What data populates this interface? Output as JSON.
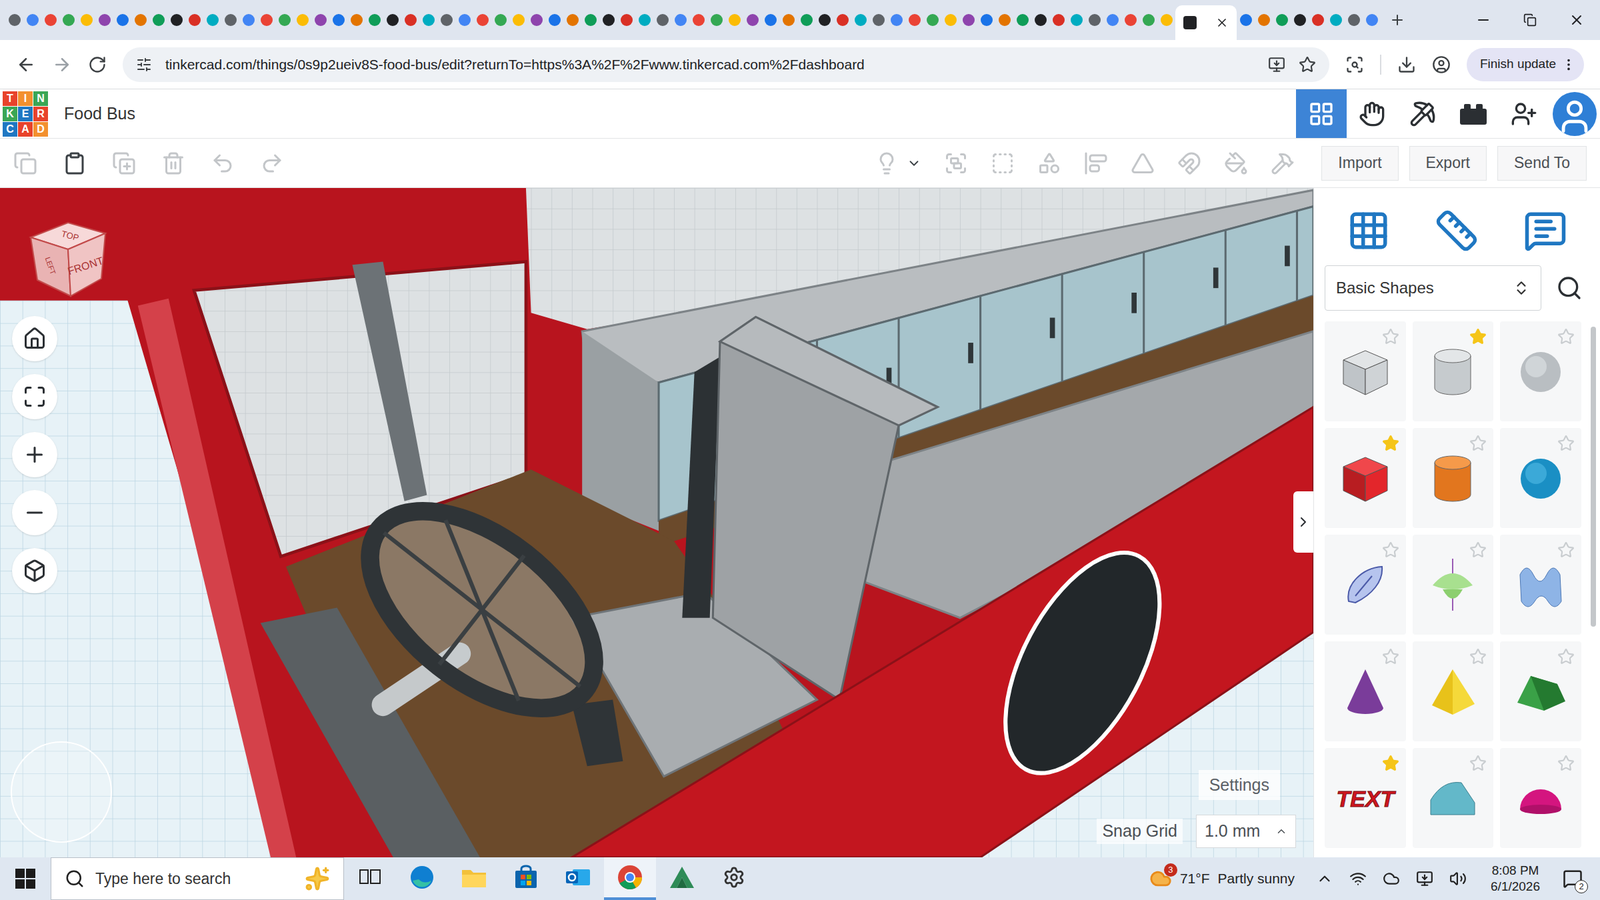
{
  "browser": {
    "tabs": [
      {
        "selected": false
      },
      {
        "selected": false
      },
      {
        "selected": false
      },
      {
        "selected": false
      },
      {
        "selected": false
      },
      {
        "selected": false
      },
      {
        "selected": false
      },
      {
        "selected": false
      },
      {
        "selected": false
      },
      {
        "selected": false
      },
      {
        "selected": false
      },
      {
        "selected": false
      },
      {
        "selected": false
      },
      {
        "selected": false
      },
      {
        "selected": false
      },
      {
        "selected": false
      },
      {
        "selected": false
      },
      {
        "selected": false
      },
      {
        "selected": false
      },
      {
        "selected": false
      },
      {
        "selected": false
      },
      {
        "selected": false
      },
      {
        "selected": false
      },
      {
        "selected": false
      },
      {
        "selected": false
      },
      {
        "selected": false
      },
      {
        "selected": false
      },
      {
        "selected": false
      },
      {
        "selected": false
      },
      {
        "selected": false
      },
      {
        "selected": false
      },
      {
        "selected": false
      },
      {
        "selected": false
      },
      {
        "selected": false
      },
      {
        "selected": false
      },
      {
        "selected": false
      },
      {
        "selected": false
      },
      {
        "selected": false
      },
      {
        "selected": false
      },
      {
        "selected": false
      },
      {
        "selected": false
      },
      {
        "selected": false
      },
      {
        "selected": false
      },
      {
        "selected": false
      },
      {
        "selected": false
      },
      {
        "selected": false
      },
      {
        "selected": false
      },
      {
        "selected": false
      },
      {
        "selected": false
      },
      {
        "selected": false
      },
      {
        "selected": false
      },
      {
        "selected": false
      },
      {
        "selected": false
      },
      {
        "selected": false
      },
      {
        "selected": false
      },
      {
        "selected": false
      },
      {
        "selected": false
      },
      {
        "selected": false
      },
      {
        "selected": false
      },
      {
        "selected": false
      },
      {
        "selected": false
      },
      {
        "selected": false
      },
      {
        "selected": false
      },
      {
        "selected": false
      },
      {
        "selected": false
      },
      {
        "selected": true
      },
      {
        "selected": false
      },
      {
        "selected": false
      },
      {
        "selected": false
      },
      {
        "selected": false
      },
      {
        "selected": false
      },
      {
        "selected": false
      },
      {
        "selected": false
      },
      {
        "selected": false
      }
    ],
    "url": "tinkercad.com/things/0s9p2ueiv8S-food-bus/edit?returnTo=https%3A%2F%2Fwww.tinkercad.com%2Fdashboard",
    "update_button": "Finish update"
  },
  "app": {
    "logo_letters": [
      "T",
      "I",
      "N",
      "K",
      "E",
      "R",
      "C",
      "A",
      "D"
    ],
    "title": "Food Bus",
    "header_views": [
      {
        "kind": "design",
        "selected": true
      },
      {
        "kind": "sim",
        "selected": false
      },
      {
        "kind": "blocks",
        "selected": false
      },
      {
        "kind": "bricks",
        "selected": false
      }
    ]
  },
  "toolbar": {
    "edit_tools": [
      {
        "kind": "copy",
        "disabled": true
      },
      {
        "kind": "paste",
        "disabled": false
      },
      {
        "kind": "duplicate",
        "disabled": true
      },
      {
        "kind": "delete",
        "disabled": true
      },
      {
        "kind": "undo",
        "disabled": true
      },
      {
        "kind": "redo",
        "disabled": true
      }
    ],
    "shape_tools": [
      {
        "kind": "light",
        "disabled": true
      },
      {
        "kind": "group",
        "disabled": true
      },
      {
        "kind": "ungroup",
        "disabled": true
      },
      {
        "kind": "shapes",
        "disabled": true
      },
      {
        "kind": "align",
        "disabled": true
      },
      {
        "kind": "mirror",
        "disabled": true
      },
      {
        "kind": "magnet",
        "disabled": true
      },
      {
        "kind": "paint",
        "disabled": true
      },
      {
        "kind": "cruise",
        "disabled": true
      }
    ],
    "buttons": [
      "Import",
      "Export",
      "Send To"
    ]
  },
  "viewcube": {
    "faces": [
      "TOP",
      "LEFT",
      "FRONT"
    ]
  },
  "viewport": {
    "settings": "Settings",
    "snap_grid_label": "Snap Grid",
    "snap_grid_value": "1.0 mm"
  },
  "shapes_panel": {
    "category": "Basic Shapes",
    "shapes": [
      {
        "kind": "box-hole",
        "starred": false
      },
      {
        "kind": "cylinder-hole",
        "starred": true
      },
      {
        "kind": "sphere-hole",
        "starred": false
      },
      {
        "kind": "box",
        "starred": true
      },
      {
        "kind": "cylinder",
        "starred": false
      },
      {
        "kind": "sphere",
        "starred": false
      },
      {
        "kind": "scribble",
        "starred": false
      },
      {
        "kind": "paraboloid",
        "starred": false
      },
      {
        "kind": "wave",
        "starred": false
      },
      {
        "kind": "cone",
        "starred": false
      },
      {
        "kind": "pyramid",
        "starred": false
      },
      {
        "kind": "roof",
        "starred": false
      },
      {
        "kind": "text",
        "starred": true,
        "text": "TEXT"
      },
      {
        "kind": "half-cylinder",
        "starred": false
      },
      {
        "kind": "half-sphere",
        "starred": false
      }
    ]
  },
  "taskbar": {
    "search_placeholder": "Type here to search",
    "apps": [
      {
        "kind": "task-view",
        "selected": false
      },
      {
        "kind": "edge",
        "selected": false
      },
      {
        "kind": "explorer",
        "selected": false
      },
      {
        "kind": "store",
        "selected": false
      },
      {
        "kind": "outlook",
        "selected": false
      },
      {
        "kind": "chrome",
        "selected": true
      },
      {
        "kind": "autodesk",
        "selected": false
      },
      {
        "kind": "settings",
        "selected": false
      }
    ],
    "weather": {
      "badge": "3",
      "temperature": "71°F",
      "condition": "Partly sunny"
    },
    "time": "8:08 PM",
    "date": "6/1/2026",
    "notifications": "2"
  }
}
